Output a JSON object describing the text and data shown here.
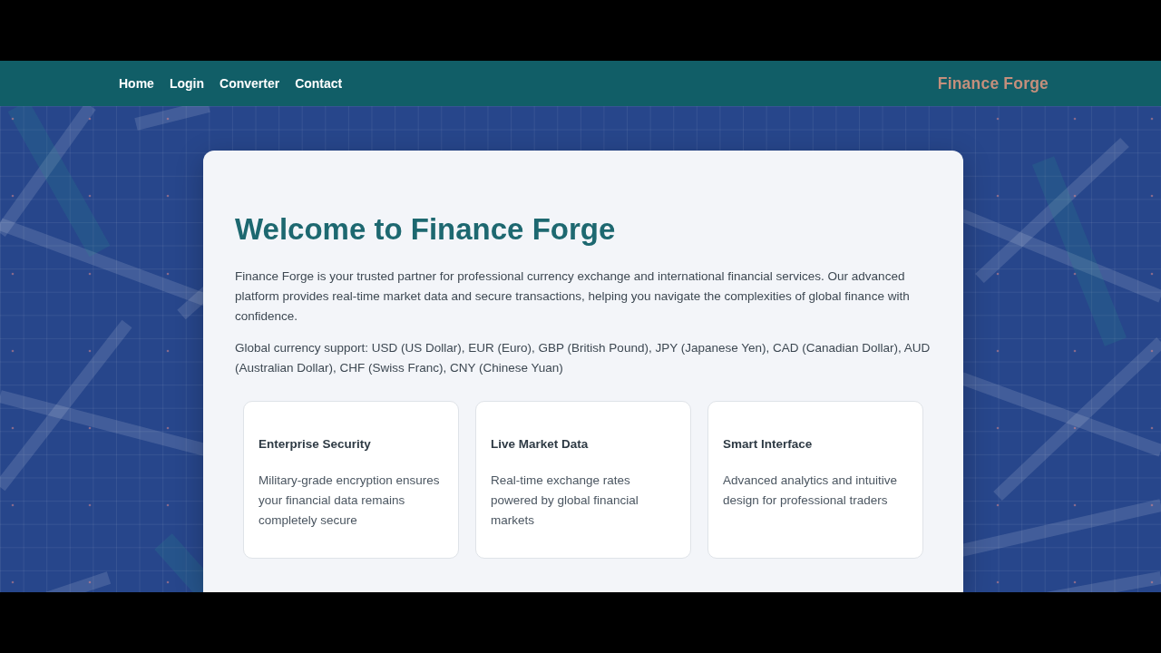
{
  "nav": {
    "links": [
      "Home",
      "Login",
      "Converter",
      "Contact"
    ],
    "brand": "Finance Forge"
  },
  "welcome": {
    "title": "Welcome to Finance Forge",
    "paragraphs": [
      "Finance Forge is your trusted partner for professional currency exchange and international financial services. Our advanced platform provides real-time market data and secure transactions, helping you navigate the complexities of global finance with confidence.",
      "Global currency support: USD (US Dollar), EUR (Euro), GBP (British Pound), JPY (Japanese Yen), CAD (Canadian Dollar), AUD (Australian Dollar), CHF (Swiss Franc), CNY (Chinese Yuan)"
    ]
  },
  "features": [
    {
      "title": "Enterprise Security",
      "description": "Military-grade encryption ensures your financial data remains completely secure"
    },
    {
      "title": "Live Market Data",
      "description": "Real-time exchange rates powered by global financial markets"
    },
    {
      "title": "Smart Interface",
      "description": "Advanced analytics and intuitive design for professional traders"
    }
  ]
}
